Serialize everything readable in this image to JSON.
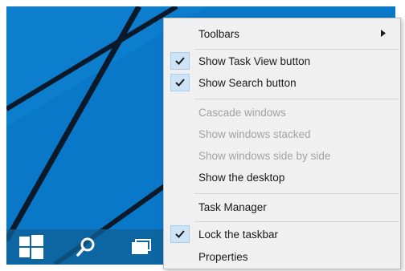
{
  "colors": {
    "desktop_blue": "#0a78c8",
    "stripe": "#0b1a2a",
    "taskbar": "#0e6096",
    "menu_bg": "#f0f0f0",
    "check_highlight": "#cde4f6",
    "disabled_text": "#a3a3a3"
  },
  "taskbar": {
    "start_icon": "windows-logo-icon",
    "search_icon": "search-icon",
    "task_view_icon": "task-view-icon"
  },
  "context_menu": {
    "toolbars": {
      "label": "Toolbars",
      "has_submenu": true
    },
    "show_task_view": {
      "label": "Show Task View button",
      "checked": true
    },
    "show_search": {
      "label": "Show Search button",
      "checked": true
    },
    "cascade": {
      "label": "Cascade windows",
      "enabled": false
    },
    "stacked": {
      "label": "Show windows stacked",
      "enabled": false
    },
    "side_by_side": {
      "label": "Show windows side by side",
      "enabled": false
    },
    "show_desktop": {
      "label": "Show the desktop",
      "enabled": true
    },
    "task_manager": {
      "label": "Task Manager"
    },
    "lock_taskbar": {
      "label": "Lock the taskbar",
      "checked": true
    },
    "properties": {
      "label": "Properties"
    }
  }
}
